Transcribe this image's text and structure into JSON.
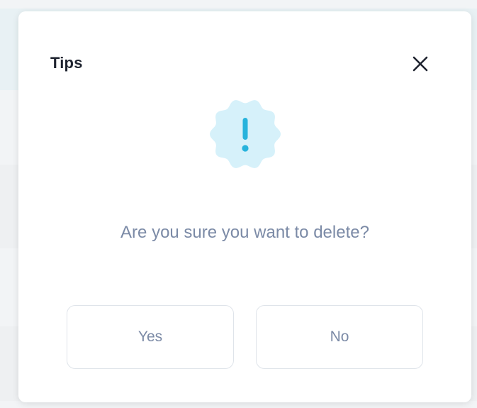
{
  "dialog": {
    "title": "Tips",
    "message": "Are you sure you want to delete?",
    "close_icon": "close-icon",
    "warning_icon": "exclamation-badge-icon",
    "buttons": {
      "yes_label": "Yes",
      "no_label": "No"
    }
  },
  "colors": {
    "badge_fill": "#d6f1fa",
    "badge_mark": "#27b3dc",
    "message_text": "#7b8aa6",
    "title_text": "#1f2430"
  }
}
